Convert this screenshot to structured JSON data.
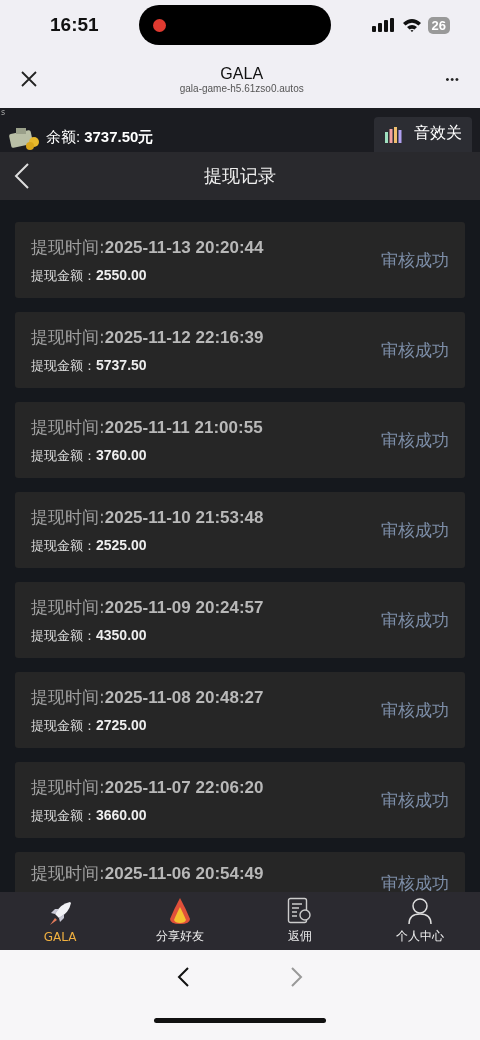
{
  "status_bar": {
    "time": "16:51",
    "battery": "26"
  },
  "browser": {
    "title": "GALA",
    "url": "gala-game-h5.61zso0.autos",
    "menu": "•••"
  },
  "header": {
    "corner_mark": "s",
    "balance_label": "余额:",
    "balance": "3737.50元",
    "sound_button": "音效关"
  },
  "nav": {
    "title": "提现记录"
  },
  "records": [
    {
      "time_label": "提现时间:",
      "time": "2025-11-13 20:20:44",
      "amount_label": "提现金额：",
      "amount": "2550.00",
      "status": "审核成功"
    },
    {
      "time_label": "提现时间:",
      "time": "2025-11-12 22:16:39",
      "amount_label": "提现金额：",
      "amount": "5737.50",
      "status": "审核成功"
    },
    {
      "time_label": "提现时间:",
      "time": "2025-11-11 21:00:55",
      "amount_label": "提现金额：",
      "amount": "3760.00",
      "status": "审核成功"
    },
    {
      "time_label": "提现时间:",
      "time": "2025-11-10 21:53:48",
      "amount_label": "提现金额：",
      "amount": "2525.00",
      "status": "审核成功"
    },
    {
      "time_label": "提现时间:",
      "time": "2025-11-09 20:24:57",
      "amount_label": "提现金额：",
      "amount": "4350.00",
      "status": "审核成功"
    },
    {
      "time_label": "提现时间:",
      "time": "2025-11-08 20:48:27",
      "amount_label": "提现金额：",
      "amount": "2725.00",
      "status": "审核成功"
    },
    {
      "time_label": "提现时间:",
      "time": "2025-11-07 22:06:20",
      "amount_label": "提现金额：",
      "amount": "3660.00",
      "status": "审核成功"
    },
    {
      "time_label": "提现时间:",
      "time": "2025-11-06 20:54:49",
      "status": "审核成功"
    }
  ],
  "tab_bar": [
    {
      "kind": "rocket",
      "label": "GALA",
      "selected": true
    },
    {
      "kind": "flame",
      "label": "分享好友",
      "selected": false
    },
    {
      "kind": "certificate",
      "label": "返佣",
      "selected": false
    },
    {
      "kind": "person",
      "label": "个人中心",
      "selected": false
    }
  ]
}
